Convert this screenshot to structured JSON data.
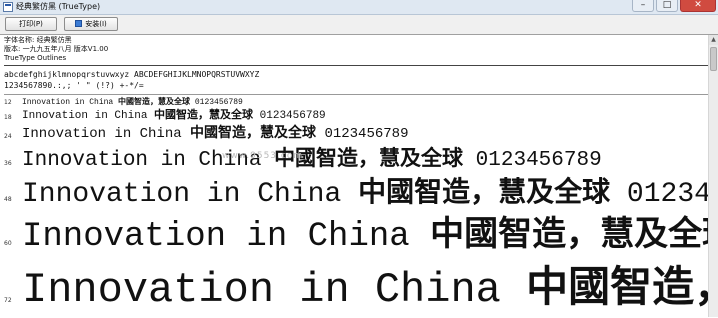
{
  "window": {
    "title": "经典繁仿黑 (TrueType)",
    "controls": {
      "minimize": "–",
      "maximize": "□",
      "close": "✕"
    }
  },
  "toolbar": {
    "print_label": "打印(P)",
    "install_label": "安装(I)"
  },
  "font_info": {
    "name_line": "字体名称: 经典繁仿黑",
    "version_line": "版本: 一九九五年八月 版本V1.00",
    "outline_line": "TrueType Outlines"
  },
  "charset": {
    "letters": "abcdefghijklmnopqrstuvwxyz ABCDEFGHIJKLMNOPQRSTUVWXYZ",
    "digits_symbols": "1234567890.:,; ' \" (!?) +-*/="
  },
  "preview": {
    "latin": "Innovation in China",
    "cjk": "中國智造，慧及全球",
    "digits": "0123456789",
    "sizes": [
      "12",
      "18",
      "24",
      "36",
      "48",
      "60",
      "72"
    ]
  },
  "watermark": "www.9553.com",
  "icons": {
    "window": "font-file-icon",
    "print": "printer-icon",
    "install": "install-shield-icon",
    "scroll_up": "arrow-up-icon"
  }
}
